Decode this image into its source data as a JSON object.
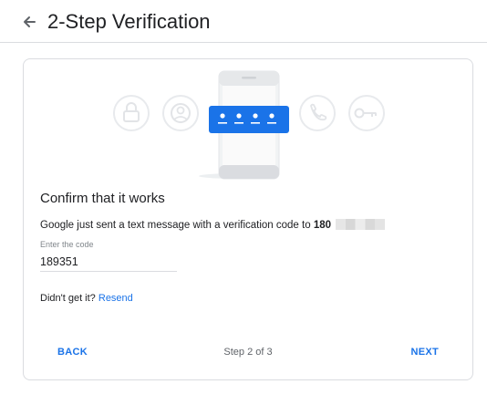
{
  "header": {
    "title": "2-Step Verification",
    "back_icon": "arrow-left-icon"
  },
  "illustration": {
    "icons": [
      "lock-icon",
      "account-circle-icon",
      "phone-call-icon",
      "key-icon"
    ],
    "code_mask_icon": "password-dots-icon",
    "accent": "#1a73e8"
  },
  "card": {
    "heading": "Confirm that it works",
    "message_prefix": "Google just sent a text message with a verification code to",
    "phone_visible": "180",
    "code_field": {
      "label": "Enter the code",
      "value": "189351"
    },
    "resend_prefix": "Didn't get it?",
    "resend_link": "Resend"
  },
  "footer": {
    "back_label": "BACK",
    "step_text": "Step 2 of 3",
    "next_label": "NEXT"
  }
}
